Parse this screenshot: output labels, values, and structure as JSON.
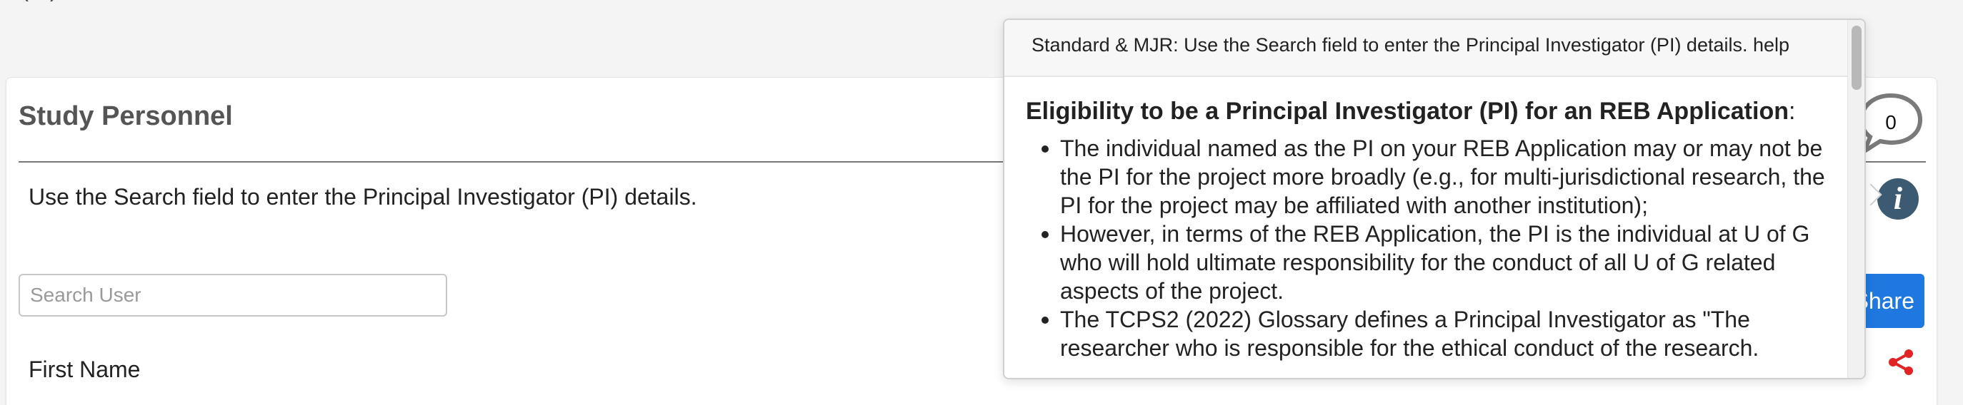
{
  "top_clip_text": "(…)",
  "section": {
    "title": "Study Personnel",
    "instructions": "Use the Search field to enter the Principal Investigator (PI) details.",
    "search_placeholder": "Search User",
    "first_name_label": "First Name"
  },
  "controls": {
    "comment_count": "0",
    "info_glyph": "i",
    "share_label": "Share",
    "comment_icon": "speech-bubble-icon",
    "info_icon": "info-icon",
    "share_icon": "share-icon"
  },
  "popover": {
    "header": "Standard & MJR: Use the Search field to enter the Principal Investigator (PI) details. help",
    "heading": "Eligibility to be a Principal Investigator (PI) for an REB Application",
    "heading_colon": ":",
    "items": [
      "The individual named as the PI on your REB Application may or may not be the PI for the project more broadly (e.g., for multi-jurisdictional research, the PI for the project may be affiliated with another institution);",
      "However, in terms of the REB Application, the PI is the individual at U of G who will hold ultimate responsibility for the conduct of all U of G related aspects of the project.",
      "The TCPS2 (2022) Glossary defines a Principal Investigator as \"The researcher who is responsible for the ethical conduct of the research."
    ]
  },
  "colors": {
    "accent_button": "#1f78e0",
    "info_icon_bg": "#3d5a73",
    "share_icon": "#e02424"
  }
}
